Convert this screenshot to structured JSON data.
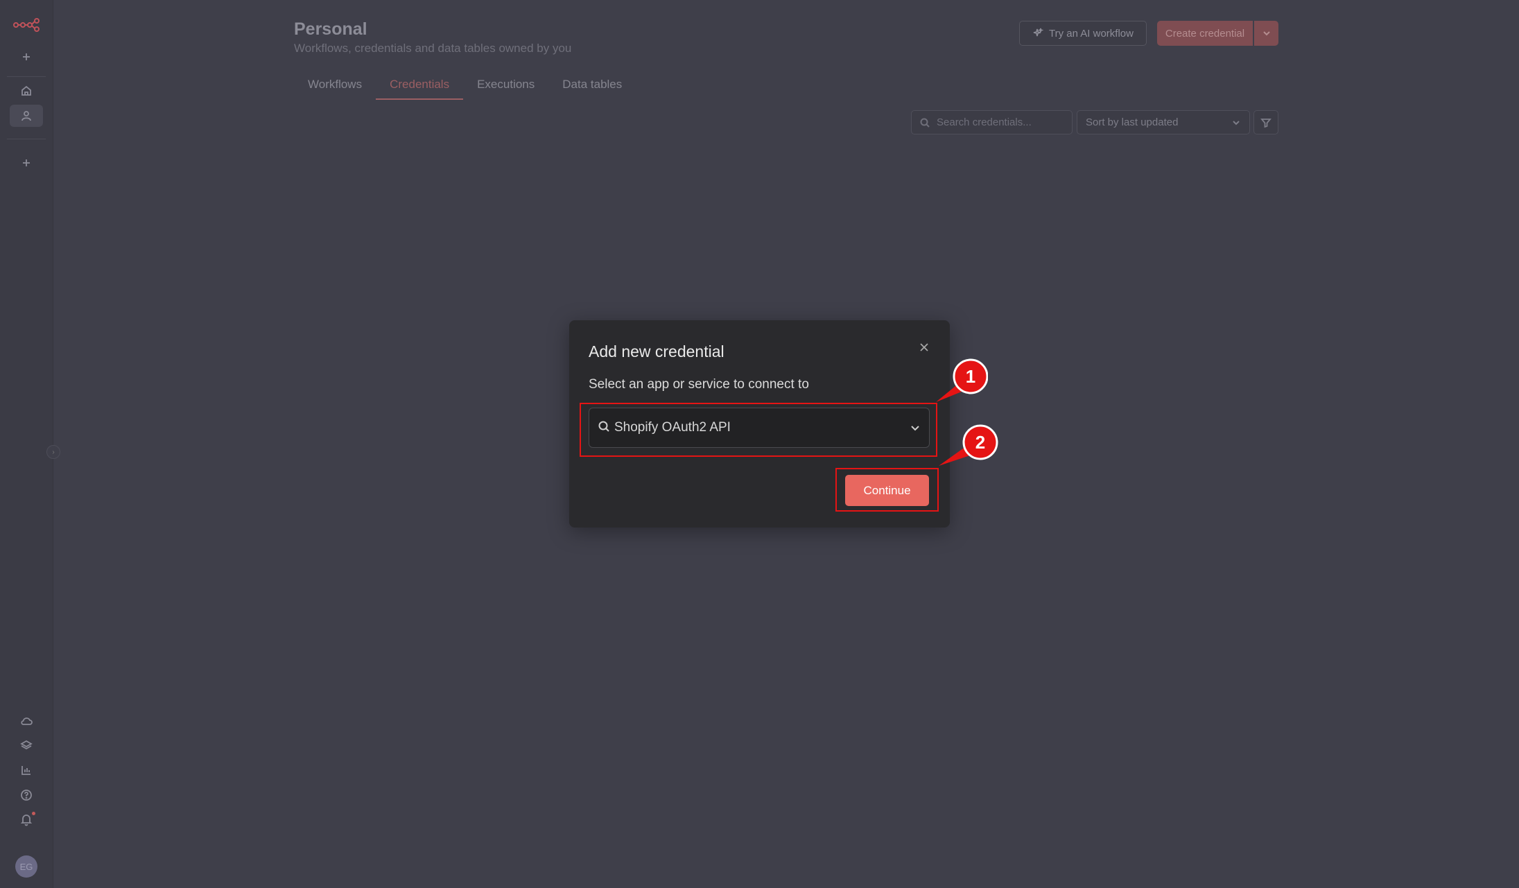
{
  "colors": {
    "background": "#3f3f4a",
    "accent": "#e8675f",
    "annotation": "#e51414"
  },
  "sidebar": {
    "logo_icon": "n8n-logo-icon",
    "top_items": [
      {
        "icon": "plus-icon",
        "name": "create"
      },
      {
        "icon": "home-icon",
        "name": "overview"
      },
      {
        "icon": "user-icon",
        "name": "personal",
        "active": true
      },
      {
        "icon": "plus-icon",
        "name": "add-project"
      }
    ],
    "bottom_items": [
      {
        "icon": "cloud-icon",
        "name": "admin-panel"
      },
      {
        "icon": "layers-icon",
        "name": "templates"
      },
      {
        "icon": "chart-icon",
        "name": "insights"
      },
      {
        "icon": "help-icon",
        "name": "help"
      },
      {
        "icon": "bell-icon",
        "name": "notifications"
      }
    ],
    "avatar_initials": "EG"
  },
  "header": {
    "title": "Personal",
    "subtitle": "Workflows, credentials and data tables owned by you",
    "ai_button": "Try an AI workflow",
    "create_button": "Create credential"
  },
  "tabs": [
    {
      "label": "Workflows"
    },
    {
      "label": "Credentials",
      "active": true
    },
    {
      "label": "Executions"
    },
    {
      "label": "Data tables"
    }
  ],
  "toolbar": {
    "search_placeholder": "Search credentials...",
    "sort_value": "Sort by last updated"
  },
  "modal": {
    "title": "Add new credential",
    "label": "Select an app or service to connect to",
    "selected_value": "Shopify OAuth2 API",
    "continue_label": "Continue"
  },
  "annotations": [
    {
      "number": "1",
      "target": "app-select"
    },
    {
      "number": "2",
      "target": "continue-button"
    }
  ]
}
